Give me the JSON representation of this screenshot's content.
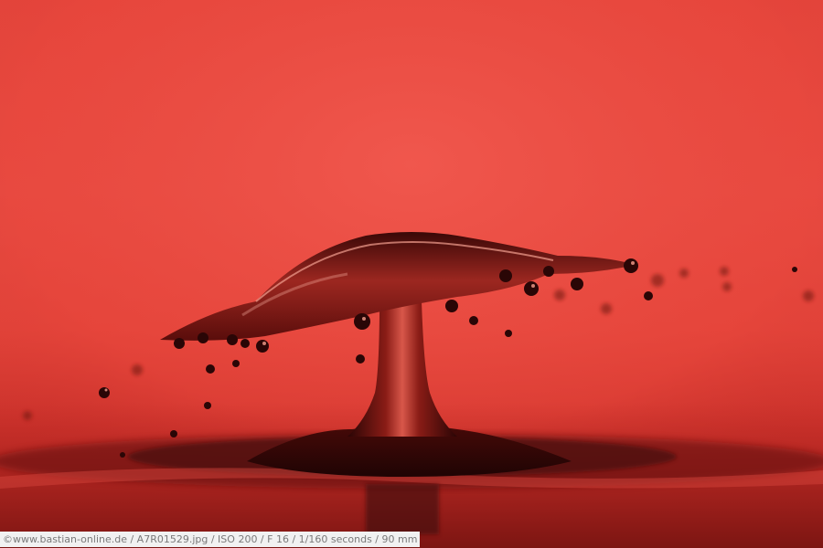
{
  "photo": {
    "caption": "©www.bastian-online.de / A7R01529.jpg / ISO 200 / F 16 / 1/160 seconds  / 90 mm",
    "colors": {
      "background_top": "#e9493f",
      "background_bottom": "#a8201d",
      "liquid_dark": "#2a0606",
      "liquid_mid": "#7a1512",
      "highlight": "#f7a08f"
    }
  }
}
